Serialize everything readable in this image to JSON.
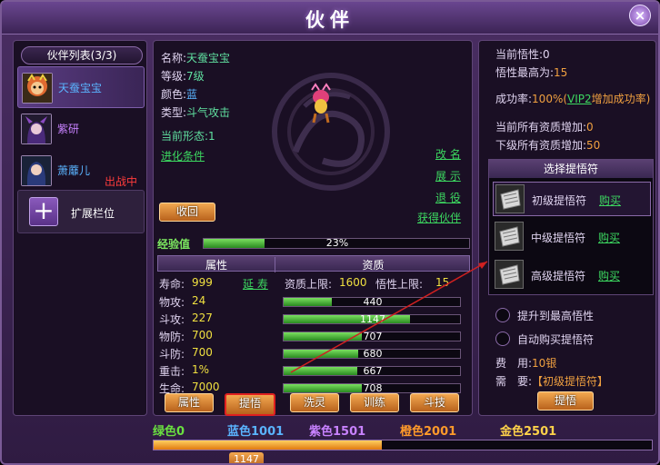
{
  "window": {
    "title": "伙伴",
    "close": "×"
  },
  "companion_list": {
    "title": "伙伴列表(3/3)",
    "items": [
      {
        "name": "天蚕宝宝",
        "color": "#5ab4ff",
        "selected": true,
        "status": ""
      },
      {
        "name": "紫研",
        "color": "#c882ff",
        "selected": false,
        "status": ""
      },
      {
        "name": "萧蘼儿",
        "color": "#5ab4ff",
        "selected": false,
        "status": "出战中"
      }
    ],
    "expand_label": "扩展栏位"
  },
  "details": {
    "name_label": "名称:",
    "name": "天蚕宝宝",
    "level_label": "等级:",
    "level": "7级",
    "color_label": "颜色:",
    "color": "蓝",
    "type_label": "类型:",
    "type": "斗气攻击",
    "form_label": "当前形态:",
    "form": "1",
    "evolve": "进化条件",
    "rename": "改 名",
    "show": "展 示",
    "retire": "退 役",
    "gain": "获得伙伴",
    "recall_button": "收回"
  },
  "exp": {
    "label": "经验值",
    "value_text": "23%",
    "fraction": 0.23
  },
  "tabs": {
    "attributes": "属性",
    "aptitude": "资质"
  },
  "attributes": {
    "life": {
      "label": "寿命:",
      "value": "999",
      "extend": "延 寿"
    },
    "aptitude_cap_label": "资质上限:",
    "aptitude_cap": "1600",
    "insight_cap_label": "悟性上限:",
    "insight_cap": "15",
    "rows": [
      {
        "label": "物攻:",
        "value": "24",
        "bar_text": "440",
        "fraction": 0.275
      },
      {
        "label": "斗攻:",
        "value": "227",
        "bar_text": "1147",
        "fraction": 0.717
      },
      {
        "label": "物防:",
        "value": "700",
        "bar_text": "707",
        "fraction": 0.442
      },
      {
        "label": "斗防:",
        "value": "700",
        "bar_text": "680",
        "fraction": 0.425
      },
      {
        "label": "重击:",
        "value": "1%",
        "bar_text": "667",
        "fraction": 0.417
      },
      {
        "label": "生命:",
        "value": "7000",
        "bar_text": "708",
        "fraction": 0.442
      }
    ]
  },
  "bottom_buttons": {
    "attr": "属性",
    "insight": "提悟",
    "wash": "洗灵",
    "train": "训练",
    "fight": "斗技"
  },
  "insight": {
    "current_label": "当前悟性:",
    "current": "0",
    "max_label": "悟性最高为:",
    "max": "15",
    "success_label": "成功率:",
    "success": "100%",
    "vip": "VIP2",
    "vip_suffix": "增加成功率)",
    "success_paren": "(",
    "cur_bonus_label": "当前所有资质增加:",
    "cur_bonus": "0",
    "next_bonus_label": "下级所有资质增加:",
    "next_bonus": "50",
    "choose_title": "选择提悟符",
    "scrolls": [
      {
        "name": "初级提悟符",
        "buy": "购买",
        "selected": true
      },
      {
        "name": "中级提悟符",
        "buy": "购买",
        "selected": false
      },
      {
        "name": "高级提悟符",
        "buy": "购买",
        "selected": false
      }
    ],
    "opt_max": "提升到最高悟性",
    "opt_auto": "自动购买提悟符",
    "cost_label": "费　用:",
    "cost": "10银",
    "need_label": "需　要:",
    "need": "【初级提悟符】",
    "button": "提悟"
  },
  "quality": {
    "green": "绿色0",
    "blue": "蓝色1001",
    "purple": "紫色1501",
    "orange": "橙色2001",
    "gold": "金色2501",
    "current": "1147",
    "fraction": 0.458,
    "colors": {
      "green": "#6ae040",
      "blue": "#5ab4ff",
      "purple": "#c882ff",
      "orange": "#ff9a2a",
      "gold": "#ffd24a"
    }
  }
}
